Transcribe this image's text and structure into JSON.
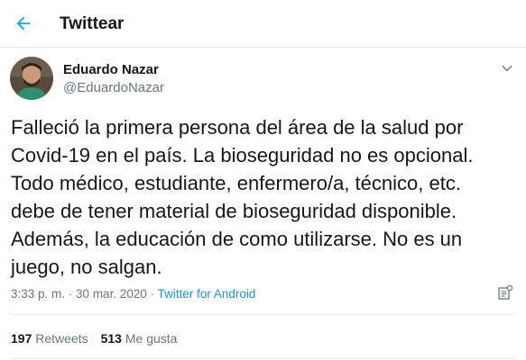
{
  "header": {
    "title": "Twittear",
    "back_icon": "arrow-left-icon",
    "accent_color": "#1da1f2"
  },
  "tweet": {
    "author": {
      "name": "Eduardo Nazar",
      "handle": "@EduardoNazar",
      "avatar_icon": "avatar-photo"
    },
    "menu_icon": "chevron-down-icon",
    "text": "Falleció la primera persona del área de la salud por\nCovid-19 en el país. La bioseguridad no es opcional.\nTodo médico, estudiante, enfermero/a, técnico, etc.\ndebe de tener material de bioseguridad disponible.\nAdemás, la educación de como utilizarse. No es un\njuego, no salgan.",
    "meta": {
      "time": "3:33 p. m.",
      "separator1": " · ",
      "date": "30 mar. 2020",
      "separator2": " · ",
      "source": "Twitter for Android"
    },
    "analytics_icon": "analytics-icon",
    "stats": {
      "retweets_count": "197",
      "retweets_label": "Retweets",
      "likes_count": "513",
      "likes_label": "Me gusta"
    }
  }
}
